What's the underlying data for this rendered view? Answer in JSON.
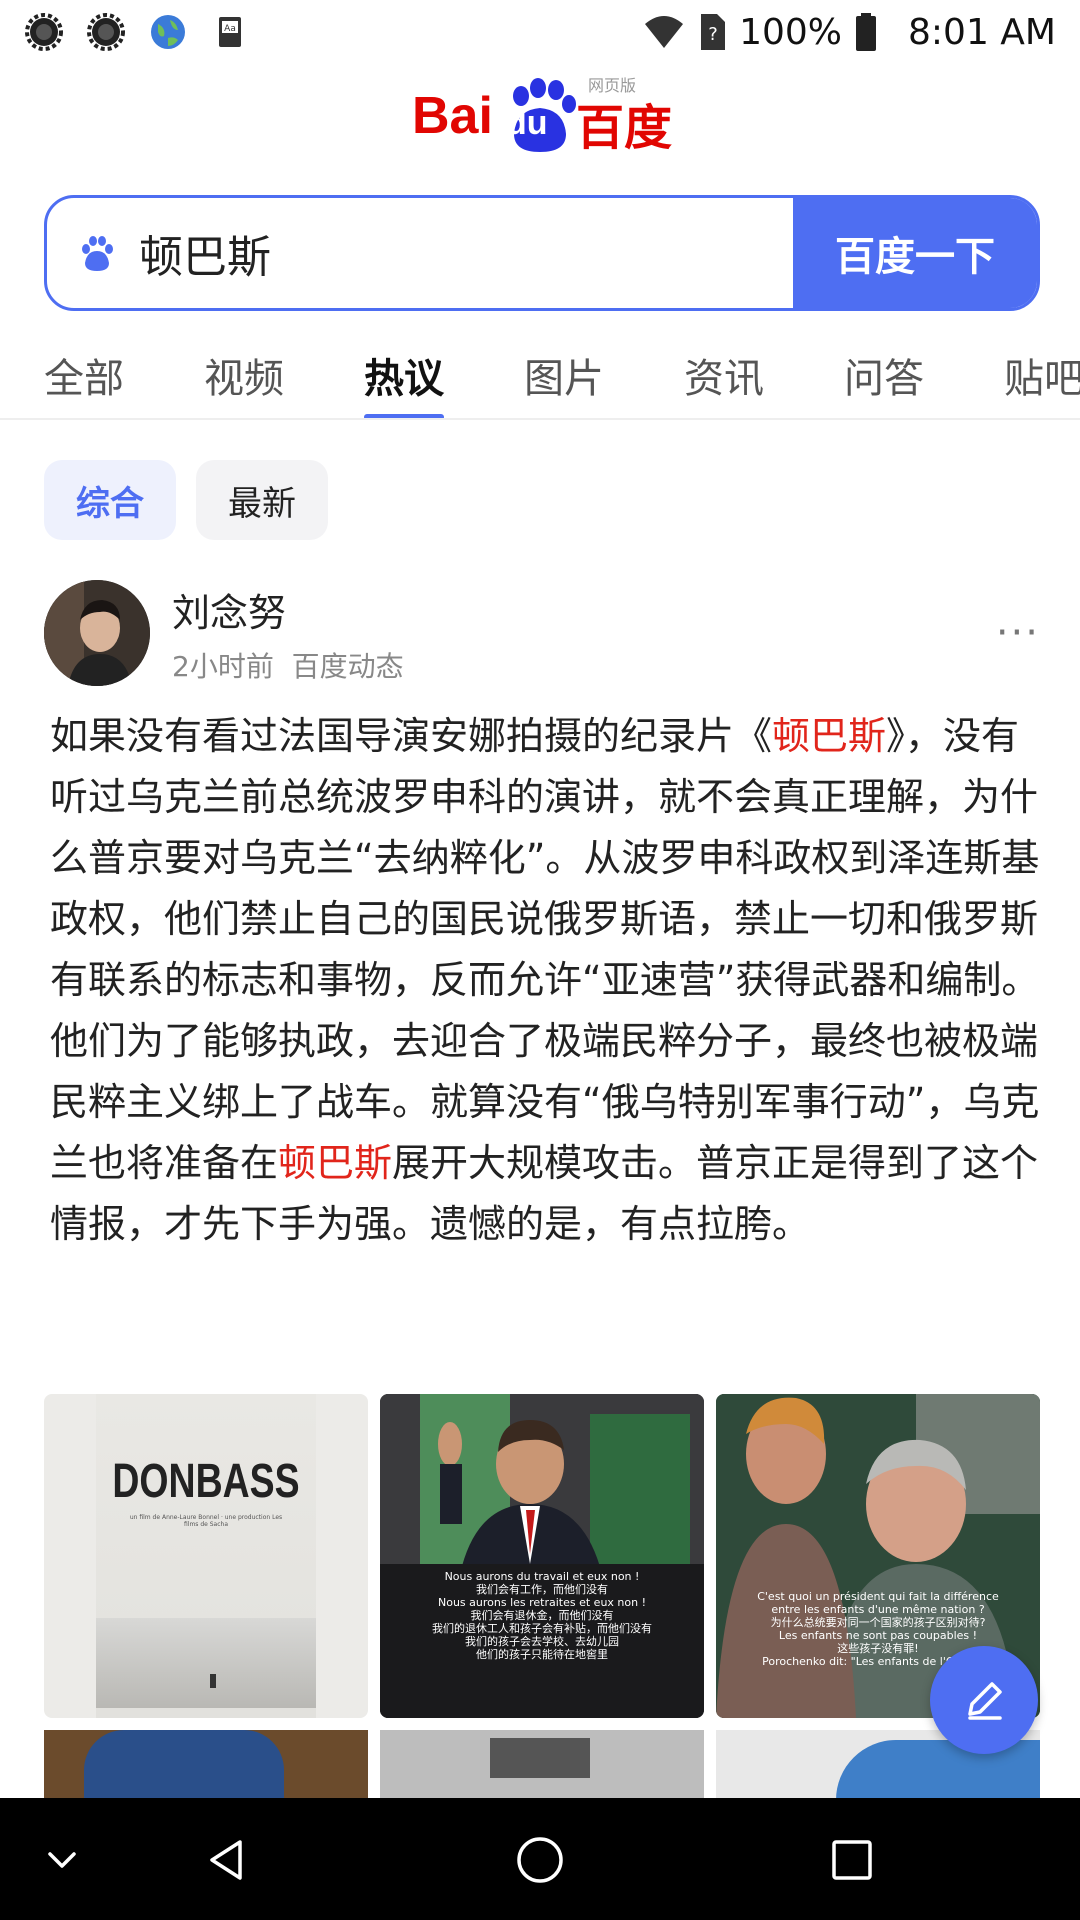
{
  "status_bar": {
    "battery": "100%",
    "time": "8:01 AM",
    "icons": [
      "settings-gear-icon",
      "settings-gear-icon",
      "globe-icon",
      "dictionary-icon",
      "wifi-icon",
      "sim-unknown-icon",
      "battery-icon"
    ]
  },
  "logo": {
    "text_left": "Bai",
    "text_mid": "du",
    "text_right": "百度",
    "sub": "网页版"
  },
  "search": {
    "query": "顿巴斯",
    "button": "百度一下"
  },
  "tabs": [
    {
      "label": "全部"
    },
    {
      "label": "视频"
    },
    {
      "label": "热议"
    },
    {
      "label": "图片"
    },
    {
      "label": "资讯"
    },
    {
      "label": "问答"
    },
    {
      "label": "贴吧"
    }
  ],
  "filters": [
    {
      "label": "综合"
    },
    {
      "label": "最新"
    }
  ],
  "post": {
    "author": "刘念努",
    "time": "2小时前",
    "source": "百度动态",
    "more": "···",
    "text": {
      "p1": "如果没有看过法国导演安娜拍摄的纪录片《",
      "hl1": "顿巴斯",
      "p2": "》，没有听过乌克兰前总统波罗申科的演讲，就不会真正理解，为什么普京要对乌克兰“去纳粹化”。从波罗申科政权到泽连斯基政权，他们禁止自己的国民说俄罗斯语，禁止一切和俄罗斯有联系的标志和事物，反而允许“亚速营”获得武器和编制。他们为了能够执政，去迎合了极端民粹分子，最终也被极端民粹主义绑上了战车。就算没有“俄乌特别军事行动”，乌克兰也将准备在",
      "hl2": "顿巴斯",
      "p3": "展开大规模攻击。普京正是得到了这个情报，才先下手为强。遗憾的是，有点拉胯。"
    },
    "images": {
      "poster_title": "DONBASS",
      "poster_sub": "un film de Anne-Laure Bonnel · une production Les films de Sacha",
      "cap2_lines": [
        "Nous aurons du travail et eux non !",
        "我们会有工作，而他们没有",
        "Nous aurons les retraites et eux non !",
        "我们会有退休金，而他们没有",
        "我们的退休工人和孩子会有补贴，而他们没有",
        "我们的孩子会去学校、去幼儿园",
        "他们的孩子只能待在地窖里"
      ],
      "cap3_lines": [
        "C'est quoi un président qui fait la différence",
        "entre les enfants d'une même nation ?",
        "为什么总统要对同一个国家的孩子区别对待?",
        "Les enfants ne sont pas coupables !",
        "这些孩子没有罪!",
        "Porochenko dit: \"Les enfants de l'Ouest...\""
      ]
    }
  }
}
